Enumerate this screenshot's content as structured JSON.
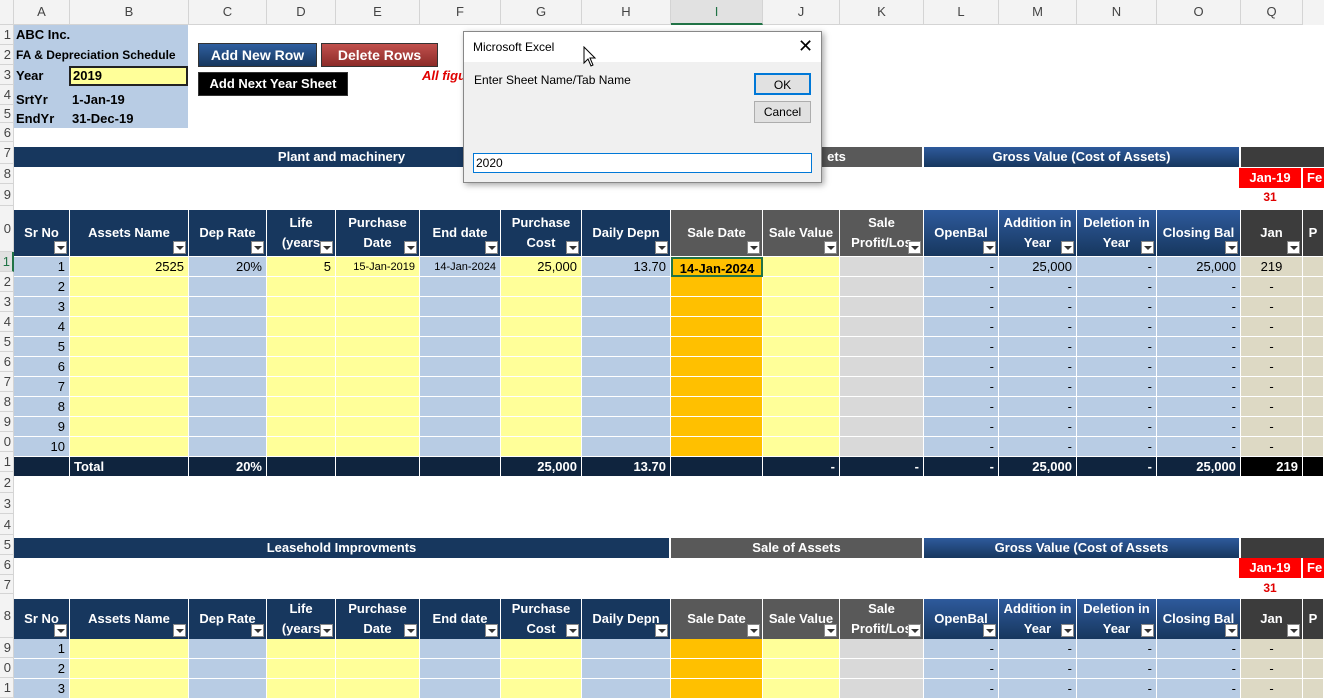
{
  "columns": [
    "A",
    "B",
    "C",
    "D",
    "E",
    "F",
    "G",
    "H",
    "I",
    "J",
    "K",
    "L",
    "M",
    "N",
    "O",
    "Q"
  ],
  "rows_top": [
    "1",
    "2",
    "3",
    "4",
    "5",
    "6",
    "7",
    "8",
    "9",
    "0",
    "1",
    "2",
    "3",
    "4",
    "5",
    "6",
    "7",
    "8",
    "9",
    "0",
    "1",
    "2",
    "3",
    "4",
    "5",
    "6",
    "7",
    "8",
    "9",
    "0",
    "1"
  ],
  "info": {
    "company": "ABC Inc.",
    "schedule": "FA & Depreciation Schedule",
    "year_label": "Year",
    "year_value": "2019",
    "srt_label": "SrtYr",
    "srt_value": "1-Jan-19",
    "end_label": "EndYr",
    "end_value": "31-Dec-19"
  },
  "buttons": {
    "add_row": "Add New Row",
    "delete_rows": "Delete Rows",
    "add_year": "Add Next Year Sheet"
  },
  "note_text": "All figu",
  "section1": {
    "title": "Plant and machinery",
    "sale_title_partial": "ets",
    "gross_title": "Gross Value (Cost of Assets)",
    "month_label": "Jan-19",
    "month_label_next": "Fe",
    "days": "31"
  },
  "section2": {
    "title": "Leasehold Improvments",
    "sale_title": "Sale of Assets",
    "gross_title": "Gross Value (Cost of Assets",
    "month_label": "Jan-19",
    "month_label_next": "Fe",
    "days": "31"
  },
  "headers": {
    "sr": "Sr No",
    "name": "Assets Name",
    "rate": "Dep Rate",
    "life1": "Life",
    "life2": "(years",
    "pd1": "Purchase",
    "pd2": "Date",
    "end": "End date",
    "pc1": "Purchase",
    "pc2": "Cost",
    "daily": "Daily Depn",
    "saled": "Sale Date",
    "salev": "Sale Value",
    "spl1": "Sale",
    "spl2": "Profit/Los",
    "open": "OpenBal",
    "add1": "Addition in",
    "add2": "Year",
    "del1": "Deletion in",
    "del2": "Year",
    "close": "Closing Bal",
    "jan": "Jan",
    "p": "P"
  },
  "rows": [
    {
      "sr": "1",
      "name": "2525",
      "rate": "20%",
      "life": "5",
      "pdate": "15-Jan-2019",
      "edate": "14-Jan-2024",
      "cost": "25,000",
      "daily": "13.70",
      "saledate": "14-Jan-2024",
      "salev": "",
      "spl": "",
      "open": "-",
      "add": "25,000",
      "del": "-",
      "close": "25,000",
      "jan": "219"
    },
    {
      "sr": "2",
      "open": "-",
      "add": "-",
      "del": "-",
      "close": "-",
      "jan": "-"
    },
    {
      "sr": "3",
      "open": "-",
      "add": "-",
      "del": "-",
      "close": "-",
      "jan": "-"
    },
    {
      "sr": "4",
      "open": "-",
      "add": "-",
      "del": "-",
      "close": "-",
      "jan": "-"
    },
    {
      "sr": "5",
      "open": "-",
      "add": "-",
      "del": "-",
      "close": "-",
      "jan": "-"
    },
    {
      "sr": "6",
      "open": "-",
      "add": "-",
      "del": "-",
      "close": "-",
      "jan": "-"
    },
    {
      "sr": "7",
      "open": "-",
      "add": "-",
      "del": "-",
      "close": "-",
      "jan": "-"
    },
    {
      "sr": "8",
      "open": "-",
      "add": "-",
      "del": "-",
      "close": "-",
      "jan": "-"
    },
    {
      "sr": "9",
      "open": "-",
      "add": "-",
      "del": "-",
      "close": "-",
      "jan": "-"
    },
    {
      "sr": "10",
      "open": "-",
      "add": "-",
      "del": "-",
      "close": "-",
      "jan": "-"
    }
  ],
  "total": {
    "label": "Total",
    "rate": "20%",
    "cost": "25,000",
    "daily": "13.70",
    "salev": "-",
    "spl": "-",
    "open": "-",
    "add": "25,000",
    "del": "-",
    "close": "25,000",
    "jan": "219"
  },
  "rows2": [
    {
      "sr": "1",
      "open": "-",
      "add": "-",
      "del": "-",
      "close": "-",
      "jan": "-"
    },
    {
      "sr": "2",
      "open": "-",
      "add": "-",
      "del": "-",
      "close": "-",
      "jan": "-"
    },
    {
      "sr": "3",
      "open": "-",
      "add": "-",
      "del": "-",
      "close": "-",
      "jan": "-"
    }
  ],
  "dialog": {
    "title": "Microsoft Excel",
    "prompt": "Enter Sheet Name/Tab Name",
    "ok": "OK",
    "cancel": "Cancel",
    "input_value": "2020"
  }
}
